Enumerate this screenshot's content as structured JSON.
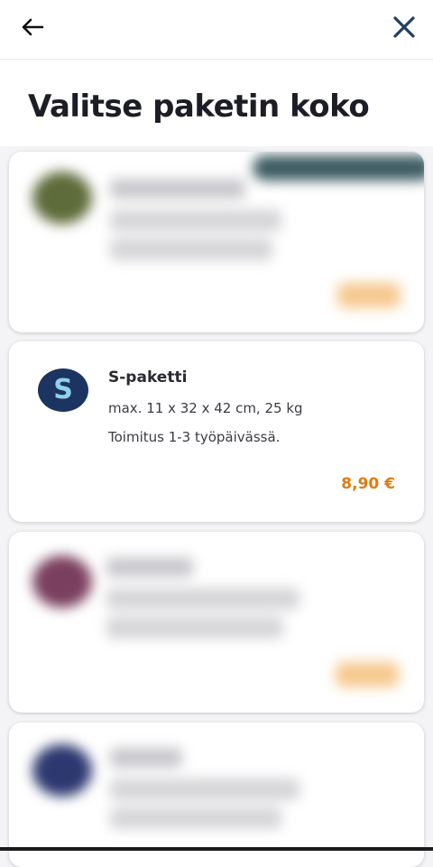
{
  "header": {
    "back_label": "",
    "close_label": ""
  },
  "page": {
    "title": "Valitse paketin koko"
  },
  "packages": [
    {
      "name": "S-paketti",
      "logo_letter": "S",
      "dimensions": "max. 11 x 32 x 42 cm, 25 kg",
      "delivery": "Toimitus 1-3 työpäivässä.",
      "price": "8,90 €"
    }
  ],
  "colors": {
    "accent_price": "#e07b12",
    "s_logo_bg": "#1c3461",
    "s_logo_letter": "#8ed1ea",
    "close_icon": "#23405a"
  },
  "icons": {
    "back": "arrow-left-icon",
    "close": "close-icon"
  }
}
